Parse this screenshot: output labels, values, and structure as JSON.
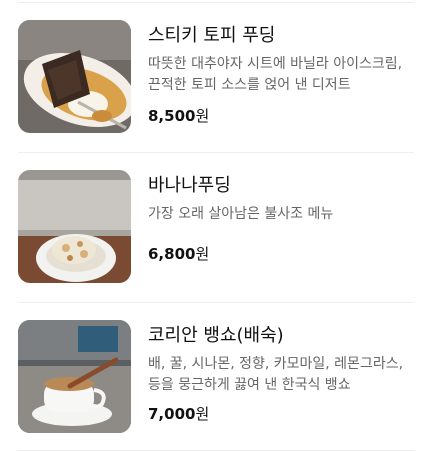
{
  "menu": {
    "items": [
      {
        "name": "스티키 토피 푸딩",
        "description": "따뜻한 대추야자 시트에 바닐라 아이스크림,끈적한 토피 소스를 얹어 낸 디저트",
        "price_value": "8,500",
        "price_unit": "원",
        "image_icon": "sticky-toffee-pudding-photo"
      },
      {
        "name": "바나나푸딩",
        "description": "가장 오래 살아남은 불사조 메뉴",
        "price_value": "6,800",
        "price_unit": "원",
        "image_icon": "banana-pudding-photo"
      },
      {
        "name": "코리안 뱅쇼(배숙)",
        "description": "배, 꿀, 시나몬, 정향, 카모마일, 레몬그라스, 등을 뭉근하게 끓여 낸 한국식 뱅쇼",
        "price_value": "7,000",
        "price_unit": "원",
        "image_icon": "korean-vin-chaud-photo"
      }
    ]
  },
  "colors": {
    "text_primary": "#111111",
    "text_secondary": "#666666",
    "divider": "#eeeeee"
  }
}
